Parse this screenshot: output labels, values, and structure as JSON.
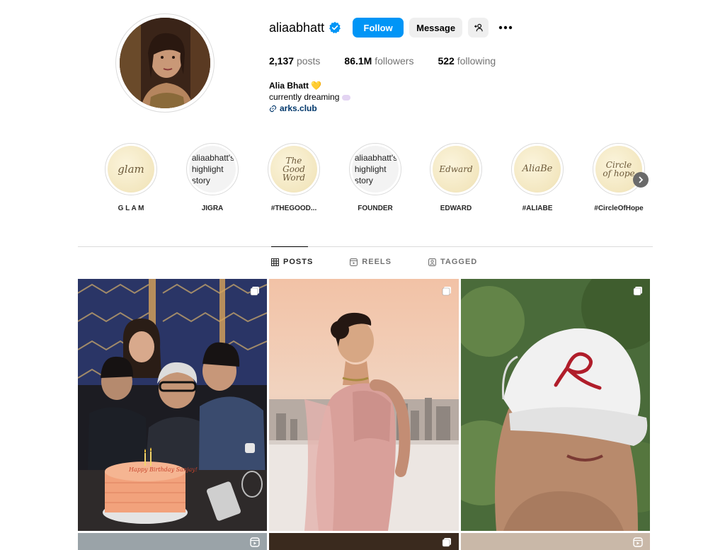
{
  "profile": {
    "username": "aliaabhatt",
    "verified": true,
    "follow_label": "Follow",
    "message_label": "Message",
    "posts_count": "2,137",
    "posts_label": "posts",
    "followers_count": "86.1M",
    "followers_label": "followers",
    "following_count": "522",
    "following_label": "following",
    "full_name": "Alia Bhatt",
    "name_emoji": "💛",
    "bio_line": "currently dreaming",
    "link": "arks.club"
  },
  "highlights": [
    {
      "label": "G L A M",
      "art": "glam",
      "style": "script"
    },
    {
      "label": "JIGRA",
      "art_lines": [
        "aliaabhatt's",
        "highlight",
        "story"
      ],
      "style": "text"
    },
    {
      "label": "#THEGOOD...",
      "art": "The Good Word",
      "style": "script"
    },
    {
      "label": "FOUNDER",
      "art_lines": [
        "aliaabhatt's",
        "highlight",
        "story"
      ],
      "style": "text"
    },
    {
      "label": "EDWARD",
      "art": "Edward",
      "style": "script"
    },
    {
      "label": "#ALIABE",
      "art": "AliaBe",
      "style": "script"
    },
    {
      "label": "#CircleOfHope",
      "art": "Circle of hope",
      "style": "script"
    }
  ],
  "tabs": [
    {
      "label": "POSTS",
      "active": true,
      "icon": "grid-icon"
    },
    {
      "label": "REELS",
      "active": false,
      "icon": "reels-icon"
    },
    {
      "label": "TAGGED",
      "active": false,
      "icon": "tagged-icon"
    }
  ],
  "posts": [
    {
      "badge": "carousel-icon",
      "cake_text": "Happy Birthday Sanjay!"
    },
    {
      "badge": "carousel-icon"
    },
    {
      "badge": "carousel-icon"
    },
    {
      "badge": "reels-icon"
    },
    {
      "badge": "carousel-icon"
    },
    {
      "badge": "reels-icon"
    }
  ],
  "colors": {
    "accent": "#0095f6",
    "link": "#00376b",
    "muted": "#737373",
    "verified": "#0095f6"
  }
}
